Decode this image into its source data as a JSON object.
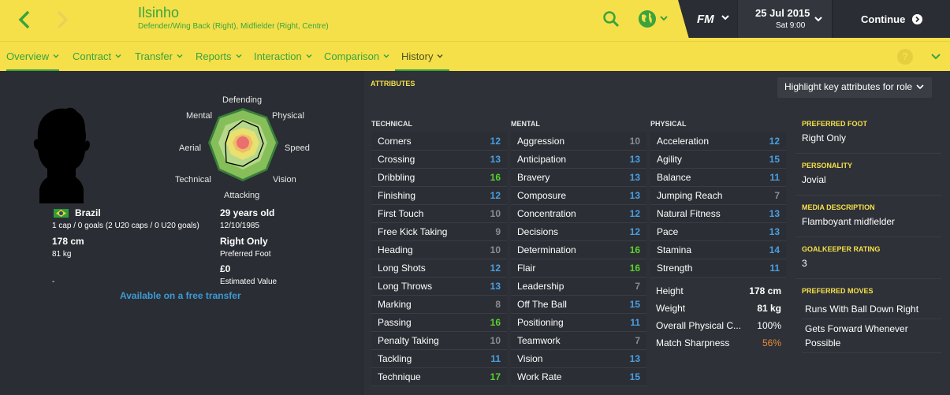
{
  "header": {
    "player_name": "Ilsinho",
    "position": "Defender/Wing Back (Right), Midfielder (Right, Centre)",
    "date": "25 Jul 2015",
    "day_time": "Sat 9:00",
    "logo": "FM",
    "continue_label": "Continue",
    "accent": "#3aa33e",
    "bg": "#f5e04a"
  },
  "tabs": [
    {
      "label": "Overview"
    },
    {
      "label": "Contract"
    },
    {
      "label": "Transfer"
    },
    {
      "label": "Reports"
    },
    {
      "label": "Interaction"
    },
    {
      "label": "Comparison"
    },
    {
      "label": "History"
    }
  ],
  "help_label": "?",
  "profile": {
    "radar_labels": {
      "defending": "Defending",
      "physical": "Physical",
      "speed": "Speed",
      "vision": "Vision",
      "attacking": "Attacking",
      "technical": "Technical",
      "aerial": "Aerial",
      "mental": "Mental"
    },
    "nationality": "Brazil",
    "caps": "1 cap / 0 goals (2 U20 caps / 0 U20 goals)",
    "height": "178 cm",
    "weight": "81 kg",
    "dash": "-",
    "age": "29 years old",
    "dob": "12/10/1985",
    "foot": "Right Only",
    "foot_label": "Preferred Foot",
    "value": "£0",
    "value_label": "Estimated Value",
    "transfer_status": "Available on a free transfer"
  },
  "attributes": {
    "title": "ATTRIBUTES",
    "highlight_label": "Highlight key attributes for role",
    "technical_header": "TECHNICAL",
    "mental_header": "MENTAL",
    "physical_header": "PHYSICAL",
    "technical": [
      {
        "name": "Corners",
        "value": "12"
      },
      {
        "name": "Crossing",
        "value": "13"
      },
      {
        "name": "Dribbling",
        "value": "16"
      },
      {
        "name": "Finishing",
        "value": "12"
      },
      {
        "name": "First Touch",
        "value": "10"
      },
      {
        "name": "Free Kick Taking",
        "value": "9"
      },
      {
        "name": "Heading",
        "value": "10"
      },
      {
        "name": "Long Shots",
        "value": "12"
      },
      {
        "name": "Long Throws",
        "value": "13"
      },
      {
        "name": "Marking",
        "value": "8"
      },
      {
        "name": "Passing",
        "value": "16"
      },
      {
        "name": "Penalty Taking",
        "value": "10"
      },
      {
        "name": "Tackling",
        "value": "11"
      },
      {
        "name": "Technique",
        "value": "17"
      }
    ],
    "mental": [
      {
        "name": "Aggression",
        "value": "10"
      },
      {
        "name": "Anticipation",
        "value": "13"
      },
      {
        "name": "Bravery",
        "value": "13"
      },
      {
        "name": "Composure",
        "value": "13"
      },
      {
        "name": "Concentration",
        "value": "12"
      },
      {
        "name": "Decisions",
        "value": "12"
      },
      {
        "name": "Determination",
        "value": "16"
      },
      {
        "name": "Flair",
        "value": "16"
      },
      {
        "name": "Leadership",
        "value": "7"
      },
      {
        "name": "Off The Ball",
        "value": "15"
      },
      {
        "name": "Positioning",
        "value": "11"
      },
      {
        "name": "Teamwork",
        "value": "7"
      },
      {
        "name": "Vision",
        "value": "13"
      },
      {
        "name": "Work Rate",
        "value": "15"
      }
    ],
    "physical": [
      {
        "name": "Acceleration",
        "value": "12"
      },
      {
        "name": "Agility",
        "value": "15"
      },
      {
        "name": "Balance",
        "value": "11"
      },
      {
        "name": "Jumping Reach",
        "value": "7"
      },
      {
        "name": "Natural Fitness",
        "value": "13"
      },
      {
        "name": "Pace",
        "value": "13"
      },
      {
        "name": "Stamina",
        "value": "14"
      },
      {
        "name": "Strength",
        "value": "11"
      }
    ],
    "physical_stats": [
      {
        "name": "Height",
        "value": "178 cm"
      },
      {
        "name": "Weight",
        "value": "81 kg"
      },
      {
        "name": "Overall Physical C...",
        "value": "100%"
      },
      {
        "name": "Match Sharpness",
        "value": "56%"
      }
    ]
  },
  "details": {
    "preferred_foot_label": "PREFERRED FOOT",
    "preferred_foot": "Right Only",
    "personality_label": "PERSONALITY",
    "personality": "Jovial",
    "media_label": "MEDIA DESCRIPTION",
    "media": "Flamboyant midfielder",
    "gk_label": "GOALKEEPER RATING",
    "gk": "3",
    "moves_label": "PREFERRED MOVES",
    "moves": [
      "Runs With Ball Down Right",
      "Gets Forward Whenever Possible"
    ]
  }
}
